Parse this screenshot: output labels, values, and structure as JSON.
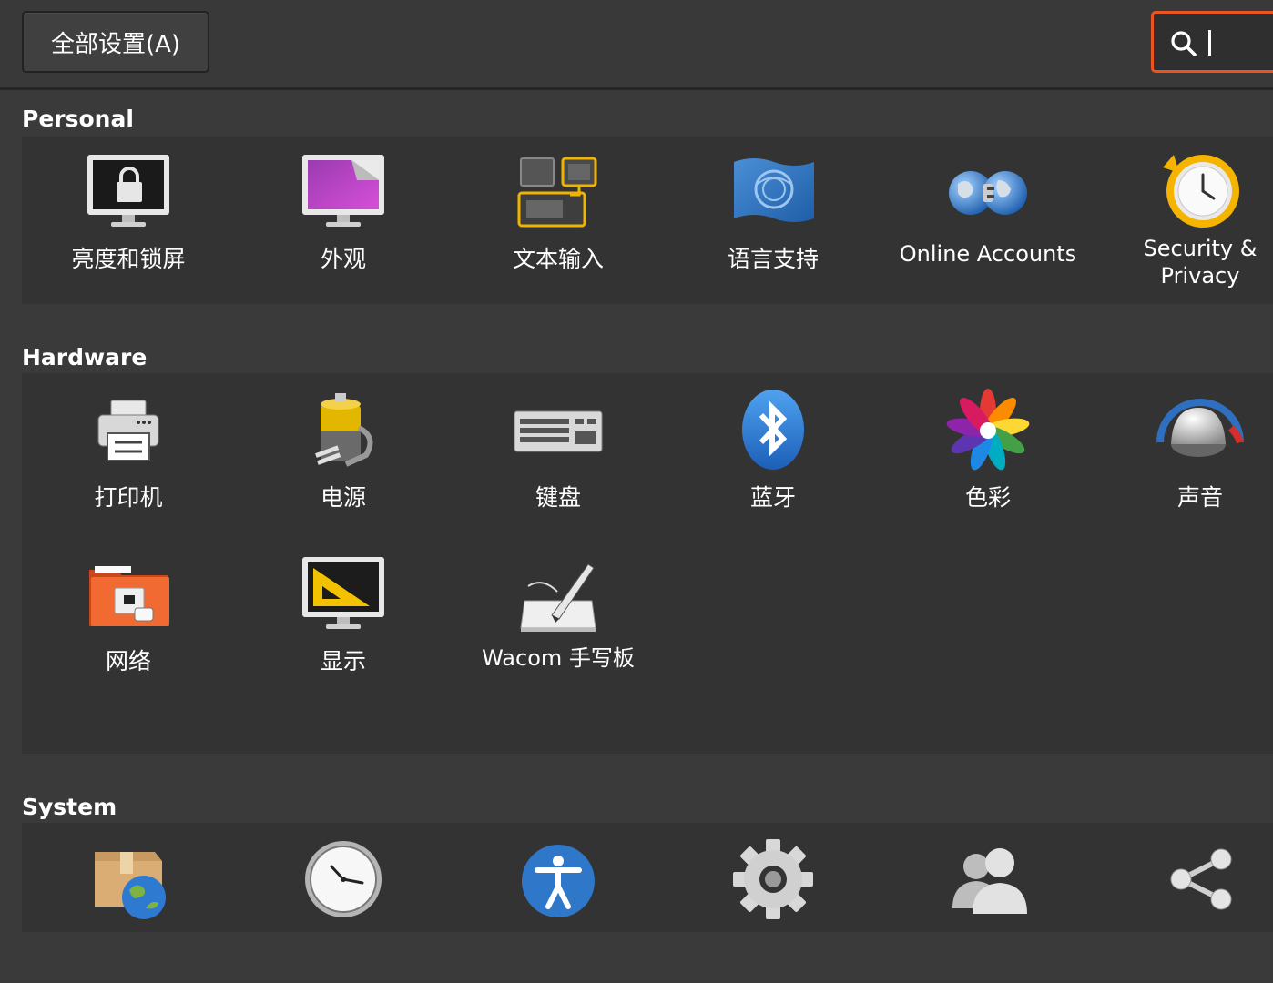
{
  "toolbar": {
    "all_settings_label": "全部设置(A)",
    "search_value": ""
  },
  "sections": {
    "personal": {
      "title": "Personal",
      "items": [
        {
          "label": "亮度和锁屏",
          "icon": "brightness-lock-icon"
        },
        {
          "label": "外观",
          "icon": "appearance-icon"
        },
        {
          "label": "文本输入",
          "icon": "text-entry-icon"
        },
        {
          "label": "语言支持",
          "icon": "language-support-icon"
        },
        {
          "label": "Online Accounts",
          "icon": "online-accounts-icon"
        },
        {
          "label": "Security &",
          "label2": "Privacy",
          "icon": "security-privacy-icon"
        }
      ]
    },
    "hardware": {
      "title": "Hardware",
      "items": [
        {
          "label": "打印机",
          "icon": "printer-icon"
        },
        {
          "label": "电源",
          "icon": "power-icon"
        },
        {
          "label": "键盘",
          "icon": "keyboard-icon"
        },
        {
          "label": "蓝牙",
          "icon": "bluetooth-icon"
        },
        {
          "label": "色彩",
          "icon": "color-icon"
        },
        {
          "label": "声音",
          "icon": "sound-icon"
        },
        {
          "label": "网络",
          "icon": "network-icon"
        },
        {
          "label": "显示",
          "icon": "display-icon"
        },
        {
          "label": "Wacom 手写板",
          "icon": "wacom-tablet-icon"
        }
      ]
    },
    "system": {
      "title": "System",
      "items": [
        {
          "icon": "software-updates-icon"
        },
        {
          "icon": "time-date-icon"
        },
        {
          "icon": "universal-access-icon"
        },
        {
          "icon": "details-gear-icon"
        },
        {
          "icon": "user-accounts-icon"
        },
        {
          "icon": "sharing-icon"
        }
      ]
    }
  },
  "colors": {
    "accent": "#e95420",
    "background": "#3a3a3a",
    "panel": "#333333"
  }
}
